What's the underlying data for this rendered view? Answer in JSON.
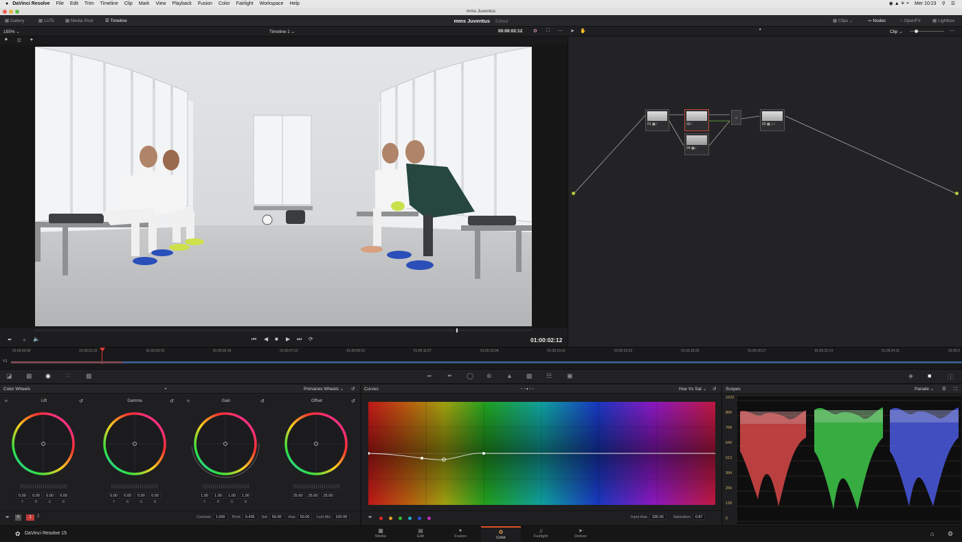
{
  "menubar": {
    "app": "DaVinci Resolve",
    "items": [
      "File",
      "Edit",
      "Trim",
      "Timeline",
      "Clip",
      "Mark",
      "View",
      "Playback",
      "Fusion",
      "Color",
      "Fairlight",
      "Workspace",
      "Help"
    ],
    "clock": "Mer 10:23"
  },
  "window": {
    "title": "mms Juventus"
  },
  "toolbar": {
    "gallery": "Gallery",
    "luts": "LUTs",
    "mediapool": "Media Pool",
    "timeline": "Timeline",
    "project": "mms Juventus",
    "project_state": "Edited",
    "clips": "Clips",
    "nodes": "Nodes",
    "openfx": "OpenFX",
    "lightbox": "Lightbox"
  },
  "viewer": {
    "zoom": "155%",
    "timeline_name": "Timeline 1",
    "timecode_top": "00:00:02:12",
    "timecode": "01:00:02:12"
  },
  "nodeeditor": {
    "mode": "Clip",
    "nodes": [
      {
        "label": "01"
      },
      {
        "label": "02"
      },
      {
        "label": "04"
      },
      {
        "label": "05"
      }
    ]
  },
  "timeline": {
    "track": "V1",
    "ticks": [
      "01:00:00:00",
      "01:00:01:22",
      "01:00:03:19",
      "01:00:05:16",
      "01:00:07:13",
      "01:00:09:10",
      "01:00:11:07",
      "01:00:13:04",
      "01:00:15:01",
      "01:00:16:23",
      "01:00:18:20",
      "01:00:20:17",
      "01:00:22:14",
      "01:00:24:11",
      "01:00:2"
    ]
  },
  "colorwheels": {
    "title": "Color Wheels",
    "mode": "Primaries Wheels",
    "channel_labels": [
      "Y",
      "R",
      "G",
      "B"
    ],
    "wheels": [
      {
        "name": "Lift",
        "values": [
          "0.00",
          "0.00",
          "0.00",
          "0.00"
        ]
      },
      {
        "name": "Gamma",
        "values": [
          "0.00",
          "0.00",
          "0.00",
          "0.00"
        ]
      },
      {
        "name": "Gain",
        "values": [
          "1.00",
          "1.00",
          "1.00",
          "1.00"
        ]
      },
      {
        "name": "Offset",
        "values": [
          "25.00",
          "25.00",
          "25.00"
        ]
      }
    ],
    "page1": "1",
    "page2": "2",
    "contrast_label": "Contrast",
    "contrast": "1.000",
    "pivot_label": "Pivot",
    "pivot": "0.435",
    "sat_label": "Sat",
    "sat": "50.00",
    "hue_label": "Hue",
    "hue": "50.00",
    "lummix_label": "Lum Mix",
    "lummix": "100.00"
  },
  "curves": {
    "title": "Curves",
    "mode": "Hue Vs Sat",
    "input_hue_label": "Input Hue",
    "input_hue": "335.00",
    "saturation_label": "Saturation",
    "saturation": "0.87",
    "swatches": [
      "#e02828",
      "#e0a020",
      "#30c030",
      "#20b0d0",
      "#3050e0",
      "#c030c0"
    ]
  },
  "scopes": {
    "title": "Scopes",
    "mode": "Parade",
    "scale": [
      "1023",
      "896",
      "768",
      "640",
      "512",
      "384",
      "256",
      "128",
      "0"
    ]
  },
  "bottombar": {
    "app": "DaVinci Resolve 15",
    "pages": [
      "Media",
      "Edit",
      "Fusion",
      "Color",
      "Fairlight",
      "Deliver"
    ],
    "selected": "Color"
  },
  "colors": {
    "accent": "#e0562a",
    "playhead": "#e23a3a",
    "panel": "#1f1f21",
    "scope_scale": "#d4b36a"
  }
}
